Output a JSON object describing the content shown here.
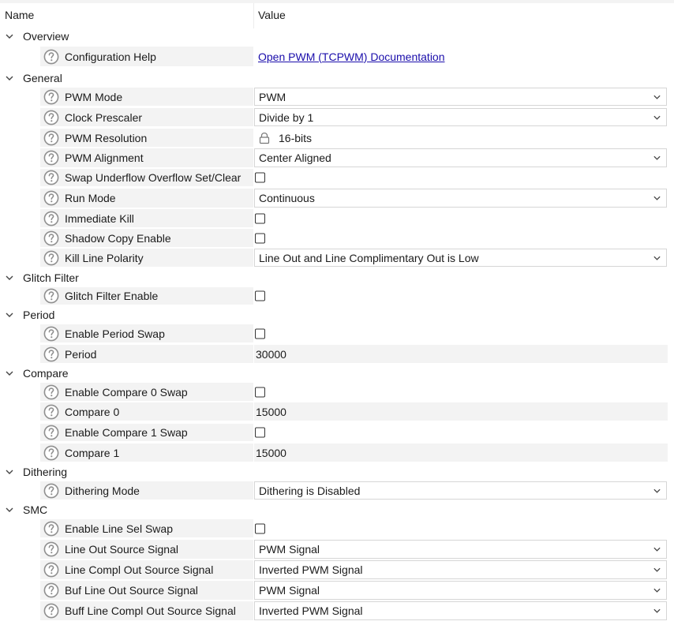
{
  "header": {
    "name_label": "Name",
    "value_label": "Value"
  },
  "icons": {
    "expander": "chevron-down-icon",
    "help": "question-circle-icon",
    "dropdown": "chevron-down-icon",
    "readonly": "lock-icon"
  },
  "colors": {
    "link": "#1a0dab",
    "row_shade": "#f3f3f3",
    "select_border": "#d6d6d6"
  },
  "rows": [
    {
      "kind": "group",
      "label": "Overview"
    },
    {
      "kind": "prop",
      "label": "Configuration Help",
      "type": "link",
      "value": "Open PWM (TCPWM) Documentation"
    },
    {
      "kind": "group",
      "label": "General"
    },
    {
      "kind": "prop",
      "label": "PWM Mode",
      "type": "select",
      "value": "PWM"
    },
    {
      "kind": "prop",
      "label": "Clock Prescaler",
      "type": "select",
      "value": "Divide by 1"
    },
    {
      "kind": "prop",
      "label": "PWM Resolution",
      "type": "readonly",
      "value": "16-bits"
    },
    {
      "kind": "prop",
      "label": "PWM Alignment",
      "type": "select",
      "value": "Center Aligned"
    },
    {
      "kind": "prop",
      "label": "Swap Underflow Overflow Set/Clear",
      "type": "checkbox",
      "checked": false
    },
    {
      "kind": "prop",
      "label": "Run Mode",
      "type": "select",
      "value": "Continuous"
    },
    {
      "kind": "prop",
      "label": "Immediate Kill",
      "type": "checkbox",
      "checked": false
    },
    {
      "kind": "prop",
      "label": "Shadow Copy Enable",
      "type": "checkbox",
      "checked": false
    },
    {
      "kind": "prop",
      "label": "Kill Line Polarity",
      "type": "select",
      "value": "Line Out and Line Complimentary Out is Low"
    },
    {
      "kind": "group",
      "label": "Glitch Filter"
    },
    {
      "kind": "prop",
      "label": "Glitch Filter Enable",
      "type": "checkbox",
      "checked": false
    },
    {
      "kind": "group",
      "label": "Period"
    },
    {
      "kind": "prop",
      "label": "Enable Period Swap",
      "type": "checkbox",
      "checked": false
    },
    {
      "kind": "prop",
      "label": "Period",
      "type": "text",
      "value": "30000"
    },
    {
      "kind": "group",
      "label": "Compare"
    },
    {
      "kind": "prop",
      "label": "Enable Compare 0 Swap",
      "type": "checkbox",
      "checked": false
    },
    {
      "kind": "prop",
      "label": "Compare 0",
      "type": "text",
      "value": "15000"
    },
    {
      "kind": "prop",
      "label": "Enable Compare 1 Swap",
      "type": "checkbox",
      "checked": false
    },
    {
      "kind": "prop",
      "label": "Compare 1",
      "type": "text",
      "value": "15000"
    },
    {
      "kind": "group",
      "label": "Dithering"
    },
    {
      "kind": "prop",
      "label": "Dithering Mode",
      "type": "select",
      "value": "Dithering is Disabled"
    },
    {
      "kind": "group",
      "label": "SMC"
    },
    {
      "kind": "prop",
      "label": "Enable Line Sel Swap",
      "type": "checkbox",
      "checked": false
    },
    {
      "kind": "prop",
      "label": "Line Out Source Signal",
      "type": "select",
      "value": "PWM Signal"
    },
    {
      "kind": "prop",
      "label": "Line Compl Out Source Signal",
      "type": "select",
      "value": "Inverted PWM Signal"
    },
    {
      "kind": "prop",
      "label": "Buf Line Out Source Signal",
      "type": "select",
      "value": "PWM Signal"
    },
    {
      "kind": "prop",
      "label": "Buff Line Compl Out Source Signal",
      "type": "select",
      "value": "Inverted PWM Signal"
    }
  ]
}
